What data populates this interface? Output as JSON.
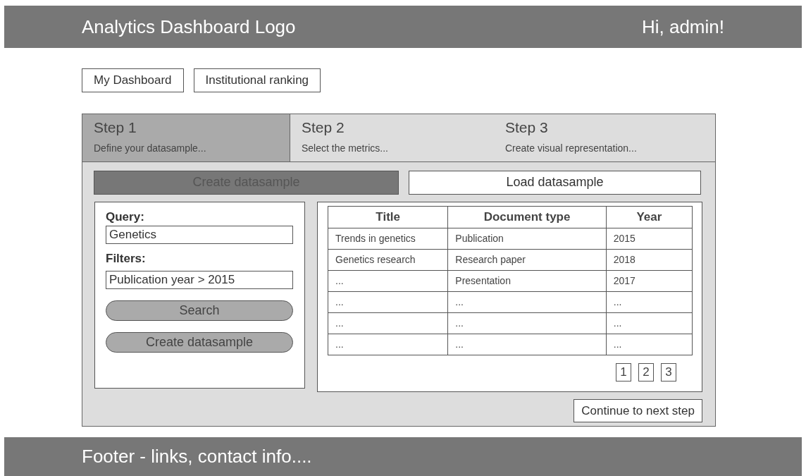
{
  "header": {
    "logo": "Analytics Dashboard Logo",
    "greeting": "Hi, admin!"
  },
  "nav": [
    "My Dashboard",
    "Institutional ranking"
  ],
  "steps": [
    {
      "title": "Step 1",
      "subtitle": "Define your datasample...",
      "selected": true
    },
    {
      "title": "Step 2",
      "subtitle": "Select the metrics...",
      "selected": false
    },
    {
      "title": "Step 3",
      "subtitle": "Create visual representation...",
      "selected": false
    }
  ],
  "modes": [
    {
      "label": "Create datasample",
      "selected": true
    },
    {
      "label": "Load datasample",
      "selected": false
    }
  ],
  "query": {
    "label": "Query:",
    "value": "Genetics"
  },
  "filters": {
    "label": "Filters:",
    "value": "Publication year > 2015"
  },
  "actions": [
    "Search",
    "Create datasample"
  ],
  "table": {
    "columns": [
      "Title",
      "Document type",
      "Year"
    ],
    "rows": [
      [
        "Trends in genetics",
        "Publication",
        "2015"
      ],
      [
        "Genetics research",
        "Research paper",
        "2018"
      ],
      [
        "...",
        "Presentation",
        "2017"
      ],
      [
        "...",
        "...",
        "..."
      ],
      [
        "...",
        "...",
        "..."
      ],
      [
        "...",
        "...",
        "..."
      ]
    ]
  },
  "pages": [
    "1",
    "2",
    "3"
  ],
  "continue": "Continue to next step",
  "footer": "Footer - links, contact info...."
}
